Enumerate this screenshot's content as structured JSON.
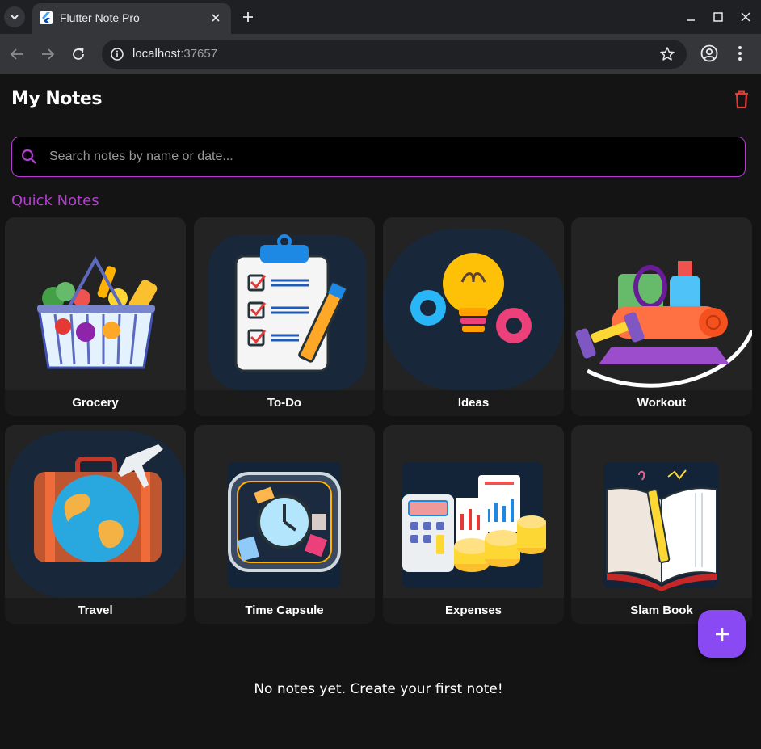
{
  "browser": {
    "tab_title": "Flutter Note Pro",
    "url_host": "localhost",
    "url_port": ":37657"
  },
  "app": {
    "title": "My Notes",
    "search_placeholder": "Search notes by name or date...",
    "section_title": "Quick Notes",
    "empty_message": "No notes yet. Create your first note!",
    "quick_notes": [
      {
        "label": "Grocery",
        "icon": "grocery-basket-icon"
      },
      {
        "label": "To-Do",
        "icon": "clipboard-checklist-icon"
      },
      {
        "label": "Ideas",
        "icon": "lightbulb-gears-icon"
      },
      {
        "label": "Workout",
        "icon": "dumbbell-mat-icon"
      },
      {
        "label": "Travel",
        "icon": "suitcase-globe-icon"
      },
      {
        "label": "Time Capsule",
        "icon": "clock-capsule-icon"
      },
      {
        "label": "Expenses",
        "icon": "calculator-coins-icon"
      },
      {
        "label": "Slam Book",
        "icon": "open-book-icon"
      }
    ]
  },
  "colors": {
    "accent": "#b73cd6",
    "fab": "#8a4af3",
    "delete": "#e53935",
    "background": "#141414",
    "card": "#232323"
  }
}
